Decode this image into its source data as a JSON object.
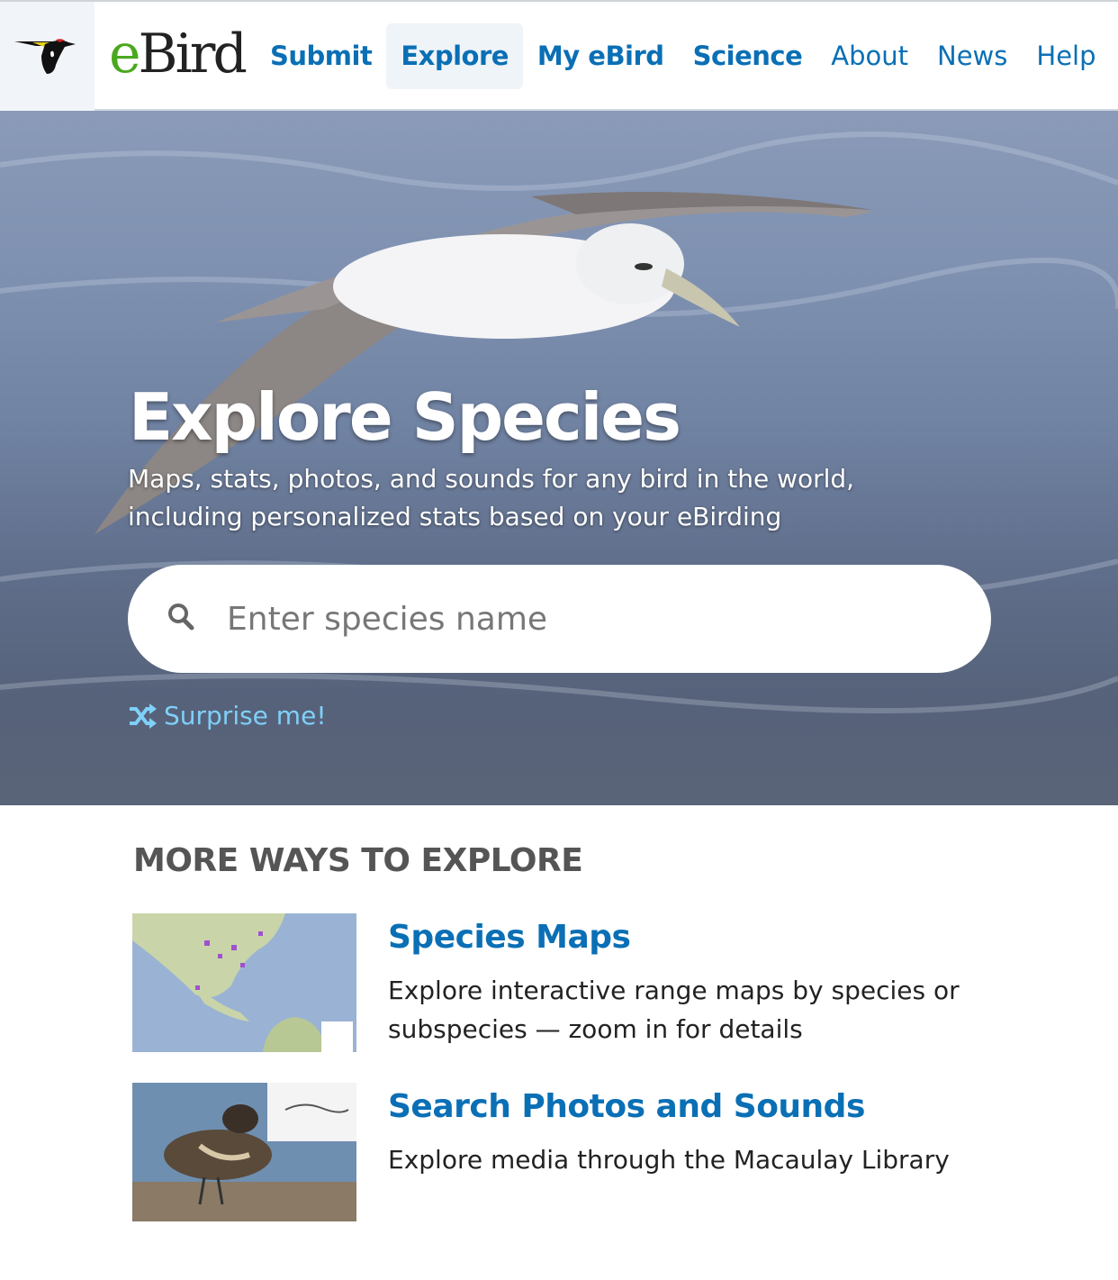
{
  "header": {
    "brand": {
      "e": "e",
      "rest": "Bird"
    },
    "nav": [
      {
        "label": "Submit",
        "bold": true
      },
      {
        "label": "Explore",
        "bold": true,
        "active": true
      },
      {
        "label": "My eBird",
        "bold": true
      },
      {
        "label": "Science",
        "bold": true
      },
      {
        "label": "About"
      },
      {
        "label": "News"
      },
      {
        "label": "Help"
      }
    ]
  },
  "hero": {
    "title": "Explore Species",
    "subtitle": "Maps, stats, photos, and sounds for any bird in the world, including personalized stats based on your eBirding",
    "search": {
      "placeholder": "Enter species name",
      "value": "",
      "icon": "search-icon"
    },
    "surprise": {
      "label": "Surprise me!",
      "icon": "shuffle-icon"
    }
  },
  "more": {
    "heading": "MORE WAYS TO EXPLORE",
    "items": [
      {
        "title": "Species Maps",
        "description": "Explore interactive range maps by species or subspecies — zoom in for details"
      },
      {
        "title": "Search Photos and Sounds",
        "description": "Explore media through the Macaulay Library"
      }
    ]
  },
  "colors": {
    "link": "#0a6fb5",
    "brand_green": "#4aa81e",
    "surprise": "#7fd0f8"
  }
}
